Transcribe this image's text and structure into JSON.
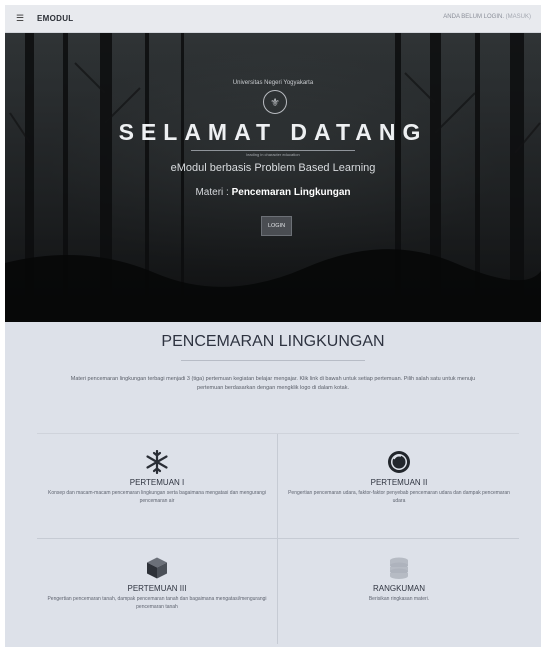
{
  "topbar": {
    "menu_icon": "hamburger-icon",
    "brand": "EMODUL",
    "status_text": "ANDA BELUM LOGIN.",
    "status_link": "(MASUK)"
  },
  "hero": {
    "university": "Universitas Negeri Yogyakarta",
    "logo_icon": "university-seal-icon",
    "title": "SELAMAT DATANG",
    "tagline": "leading in character education",
    "subtitle": "eModul berbasis Problem Based Learning",
    "materi_label": "Materi : ",
    "materi_value": "Pencemaran Lingkungan",
    "login_button": "LOGIN"
  },
  "content": {
    "title": "PENCEMARAN LINGKUNGAN",
    "intro": "Materi pencemaran lingkungan terbagi menjadi 3 (tiga) pertemuan kegiatan belajar mengajar. Klik link di bawah untuk setiap pertemuan. Pilih salah satu untuk menuju pertemuan berdasarkan dengan mengklik logo di dalam kotak.",
    "cards": [
      {
        "icon": "snowflake-icon",
        "title": "PERTEMUAN I",
        "desc": "Konsep dan macam-macam pencemaran lingkungan serta bagaimana mengatasi dan mengurangi pencemaran air"
      },
      {
        "icon": "camera-lens-icon",
        "title": "PERTEMUAN II",
        "desc": "Pengertian pencemaran udara, faktor-faktor penyebab pencemaran udara dan dampak pencemaran udara"
      },
      {
        "icon": "cube-icon",
        "title": "PERTEMUAN III",
        "desc": "Pengertian pencemaran tanah, dampak pencemaran tanah dan bagaimana mengatasi/mengurangi pencemaran tanah"
      },
      {
        "icon": "database-icon",
        "title": "RANGKUMAN",
        "desc": "Berisikan ringkasan materi."
      }
    ]
  }
}
